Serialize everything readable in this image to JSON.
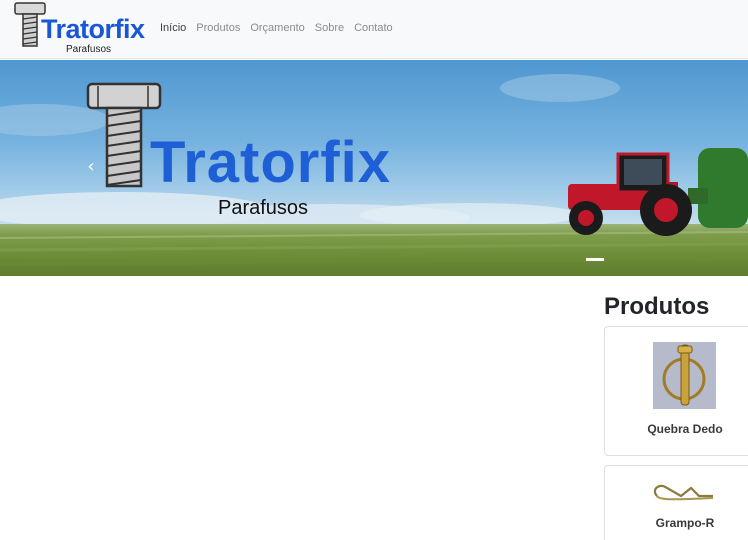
{
  "brand": {
    "name": "Tratorfix",
    "subtitle": "Parafusos"
  },
  "nav": {
    "items": [
      {
        "label": "Início",
        "active": true
      },
      {
        "label": "Produtos",
        "active": false
      },
      {
        "label": "Orçamento",
        "active": false
      },
      {
        "label": "Sobre",
        "active": false
      },
      {
        "label": "Contato",
        "active": false
      }
    ]
  },
  "hero": {
    "logo_text": "Tratorfix",
    "logo_subtitle": "Parafusos",
    "prev_icon": "chevron-left-icon",
    "slide_indicator_count": 1
  },
  "sidebar": {
    "title": "Produtos",
    "products": [
      {
        "name": "Quebra Dedo"
      },
      {
        "name": "Grampo-R"
      }
    ]
  },
  "colors": {
    "brand_blue": "#1a57d8",
    "navbar_bg": "#f8f9fa",
    "nav_text": "#8b8b8b",
    "nav_active": "#3d3d3d"
  }
}
